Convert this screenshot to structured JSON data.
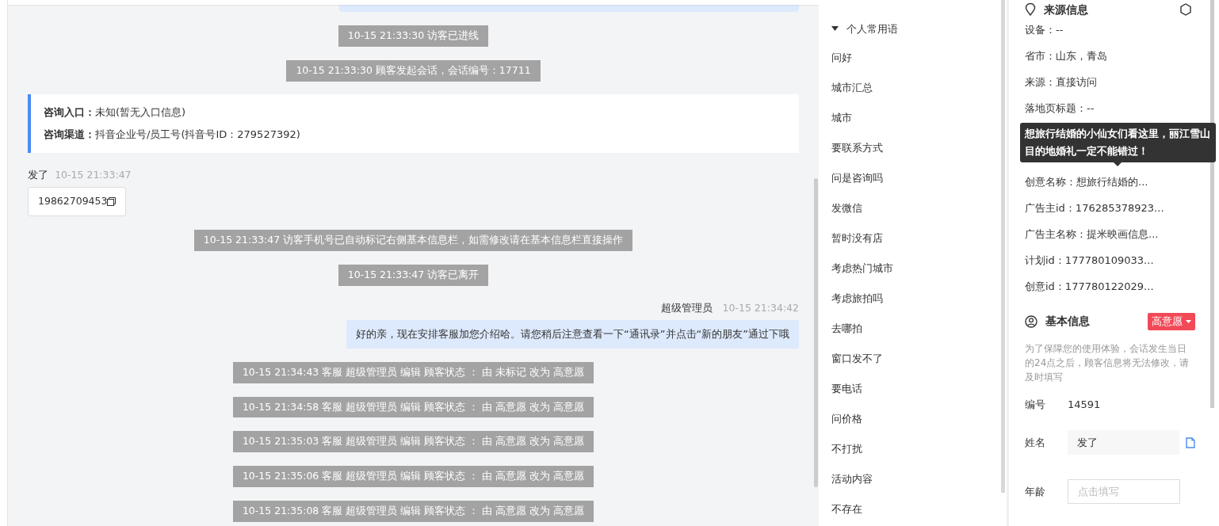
{
  "chat": {
    "messages": [
      {
        "kind": "system",
        "text": "10-15 21:33:30 访客已进线"
      },
      {
        "kind": "system",
        "text": "10-15 21:33:30 顾客发起会话，会话编号：17711"
      },
      {
        "kind": "info_card",
        "rows": [
          {
            "label": "咨询入口：",
            "value": "未知(暂无入口信息)"
          },
          {
            "label": "咨询渠道：",
            "value": "抖音企业号/员工号(抖音号ID：279527392)"
          }
        ]
      },
      {
        "kind": "visitor",
        "sender": "发了",
        "time": "10-15 21:33:47",
        "text": "19862709453"
      },
      {
        "kind": "system",
        "text": "10-15 21:33:47 访客手机号已自动标记右侧基本信息栏，如需修改请在基本信息栏直接操作"
      },
      {
        "kind": "system",
        "text": "10-15 21:33:47 访客已离开"
      },
      {
        "kind": "agent",
        "sender": "超级管理员",
        "time": "10-15 21:34:42",
        "text": "好的亲，现在安排客服加您介绍哈。请您稍后注意查看一下“通讯录”并点击“新的朋友”通过下哦"
      },
      {
        "kind": "system",
        "text": "10-15 21:34:43 客服 超级管理员 编辑 顾客状态 ： 由 未标记 改为 高意愿"
      },
      {
        "kind": "system",
        "text": "10-15 21:34:58 客服 超级管理员 编辑 顾客状态 ： 由 高意愿 改为 高意愿"
      },
      {
        "kind": "system",
        "text": "10-15 21:35:03 客服 超级管理员 编辑 顾客状态 ： 由 高意愿 改为 高意愿"
      },
      {
        "kind": "system",
        "text": "10-15 21:35:06 客服 超级管理员 编辑 顾客状态 ： 由 高意愿 改为 高意愿"
      },
      {
        "kind": "system",
        "text": "10-15 21:35:08 客服 超级管理员 编辑 顾客状态 ： 由 高意愿 改为 高意愿"
      }
    ]
  },
  "phrases": {
    "group": "个人常用语",
    "expanded": true,
    "items": [
      "问好",
      "城市汇总",
      "城市",
      "要联系方式",
      "问是咨询吗",
      "发微信",
      "暂时没有店",
      "考虑热门城市",
      "考虑旅拍吗",
      "去哪拍",
      "窗口发不了",
      "要电话",
      "问价格",
      "不打扰",
      "活动内容",
      "不存在"
    ]
  },
  "source_info": {
    "title": "来源信息",
    "rows_before": [
      "设备：--",
      "省市：山东，青岛",
      "来源：直接访问",
      "落地页标题：--"
    ],
    "tooltip": "想旅行结婚的小仙女们看这里，丽江雪山目的地婚礼一定不能错过！",
    "rows_after": [
      "创意名称：想旅行结婚的...",
      "广告主id：176285378923...",
      "广告主名称：提米映画信息...",
      "计划id：177780109033...",
      "创意id：177780122029..."
    ]
  },
  "basic_info": {
    "title": "基本信息",
    "status": "高意愿",
    "notice": "为了保障您的使用体验，会话发生当日的24点之后，顾客信息将无法修改，请及时填写",
    "fields": [
      {
        "kind": "text",
        "label": "编号",
        "value": "14591"
      },
      {
        "kind": "filled",
        "label": "姓名",
        "value": "发了"
      },
      {
        "kind": "input",
        "label": "年龄",
        "placeholder": "点击填写"
      }
    ]
  }
}
